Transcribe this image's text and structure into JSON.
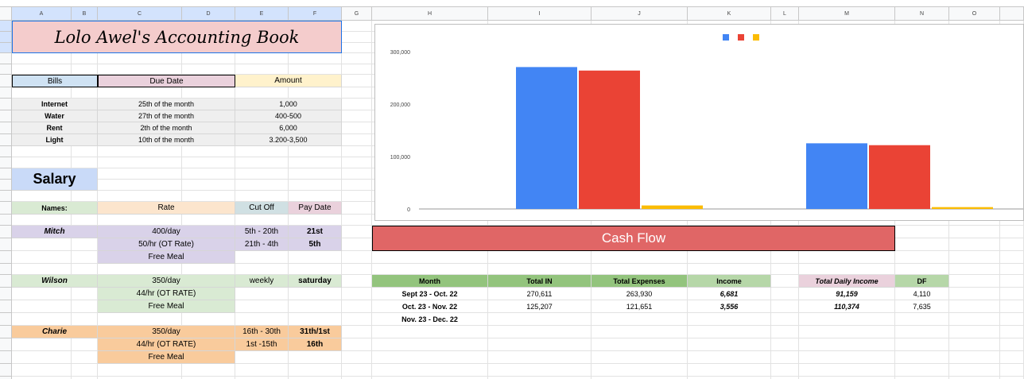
{
  "columns": [
    "A",
    "B",
    "C",
    "D",
    "E",
    "F",
    "G",
    "H",
    "I",
    "J",
    "K",
    "L",
    "M",
    "N",
    "O"
  ],
  "title": "Lolo Awel's Accounting Book",
  "bills": {
    "headers": [
      "Bills",
      "Due Date",
      "Amount"
    ],
    "rows": [
      [
        "Internet",
        "25th of the month",
        "1,000"
      ],
      [
        "Water",
        "27th of the month",
        "400-500"
      ],
      [
        "Rent",
        "2th of the month",
        "6,000"
      ],
      [
        "Light",
        "10th of the month",
        "3.200-3,500"
      ]
    ]
  },
  "salary": {
    "title": "Salary",
    "headers": [
      "Names:",
      "Rate",
      "Cut Off",
      "Pay Date"
    ],
    "mitch": {
      "name": "Mitch",
      "rates": [
        "400/day",
        "50/hr (OT Rate)",
        "Free Meal"
      ],
      "cutoff": [
        "5th - 20th",
        "21th - 4th"
      ],
      "pay": [
        "21st",
        "5th"
      ]
    },
    "wilson": {
      "name": "Wilson",
      "rates": [
        "350/day",
        "44/hr (OT RATE)",
        "Free Meal"
      ],
      "cutoff": [
        "weekly"
      ],
      "pay": [
        "saturday"
      ]
    },
    "charie": {
      "name": "Charie",
      "rates": [
        "350/day",
        "44/hr (OT RATE)",
        "Free Meal"
      ],
      "cutoff": [
        "16th - 30th",
        "1st -15th"
      ],
      "pay": [
        "31th/1st",
        "16th"
      ]
    }
  },
  "cashflow": {
    "title": "Cash Flow",
    "headers": [
      "Month",
      "Total IN",
      "Total Expenses",
      "Income"
    ],
    "rows": [
      [
        "Sept 23 - Oct. 22",
        "270,611",
        "263,930",
        "6,681"
      ],
      [
        "Oct. 23 - Nov. 22",
        "125,207",
        "121,651",
        "3,556"
      ],
      [
        "Nov. 23 - Dec. 22",
        "",
        "",
        ""
      ]
    ],
    "daily_headers": [
      "Total Daily Income",
      "DF"
    ],
    "daily_rows": [
      [
        "91,159",
        "4,110"
      ],
      [
        "110,374",
        "7,635"
      ]
    ]
  },
  "chart_data": {
    "type": "bar",
    "categories": [
      "Sept 23 - Oct. 22",
      "Oct. 23 - Nov. 22"
    ],
    "series": [
      {
        "name": "Total IN",
        "color": "#4285f4",
        "values": [
          270611,
          125207
        ]
      },
      {
        "name": "Total Expenses",
        "color": "#ea4335",
        "values": [
          263930,
          121651
        ]
      },
      {
        "name": "Income",
        "color": "#fbbc04",
        "values": [
          6681,
          3556
        ]
      }
    ],
    "yticks": [
      "0",
      "100,000",
      "200,000",
      "300,000"
    ],
    "ylim": [
      0,
      300000
    ],
    "legend": "top-center",
    "grid": false
  }
}
